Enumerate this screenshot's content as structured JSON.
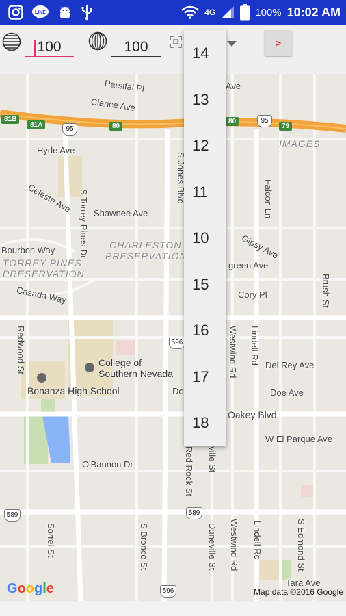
{
  "status_bar": {
    "icons_left": [
      "instagram-icon",
      "line-icon",
      "android-icon",
      "usb-icon"
    ],
    "line_label": "LINE",
    "network": "4G",
    "battery": "100%",
    "time": "10:02 AM"
  },
  "toolbar": {
    "lat_value": "100",
    "lon_value": "100",
    "go_label": ">"
  },
  "zoom_dropdown": {
    "options": [
      "14",
      "13",
      "12",
      "11",
      "10",
      "15",
      "16",
      "17",
      "18"
    ]
  },
  "map": {
    "labels": {
      "parsifal": "Parsifal Pl",
      "clarice": "Clarice Ave",
      "ave_top": "Ave",
      "hyde": "Hyde Ave",
      "images": "IMAGES",
      "celeste": "Celeste Ave",
      "torrey_dr": "S Torrey Pines Dr",
      "jones": "S Jones Blvd",
      "falcon": "Falcon Ln",
      "shawnee": "Shawnee Ave",
      "charleston1": "CHARLESTON",
      "charleston2": "PRESERVATION",
      "bourbon": "Bourbon Way",
      "torrey1": "TORREY PINES",
      "torrey2": "PRESERVATION",
      "gipsy": "Gipsy Ave",
      "evergreen": "green Ave",
      "casada": "Casada Way",
      "cory": "Cory Pl",
      "brush": "Brush St",
      "redwood": "Redwood St",
      "college1": "College of",
      "college2": "Southern Nevada",
      "westwind_top": "Westwind Rd",
      "lindell_top": "Lindell Rd",
      "delrey": "Del Rey Ave",
      "bonanza": "Bonanza High School",
      "doe_left": "Doe",
      "doe": "Doe Ave",
      "oakey": "Oakey Blvd",
      "elparque": "W El Parque Ave",
      "obannon": "O'Bannon Dr",
      "redrock": "Red Rock St",
      "dunevil_top": "ville St",
      "sorrel": "Sorrel St",
      "bronco": "S Bronco St",
      "duneville": "Duneville St",
      "westwind": "Westwind Rd",
      "lindell": "Lindell Rd",
      "edmond": "S Edmond St",
      "tara": "Tara Ave"
    },
    "shields": {
      "s81b": "81B",
      "s81a": "81A",
      "s80a": "80",
      "s80b": "80",
      "s79": "79",
      "i95a": "95",
      "i95b": "95",
      "r596a": "596",
      "r589a": "589",
      "r589b": "589",
      "r596b": "596"
    },
    "google_logo": [
      "G",
      "o",
      "o",
      "g",
      "l",
      "e"
    ],
    "attribution": "Map data ©2016 Google"
  }
}
